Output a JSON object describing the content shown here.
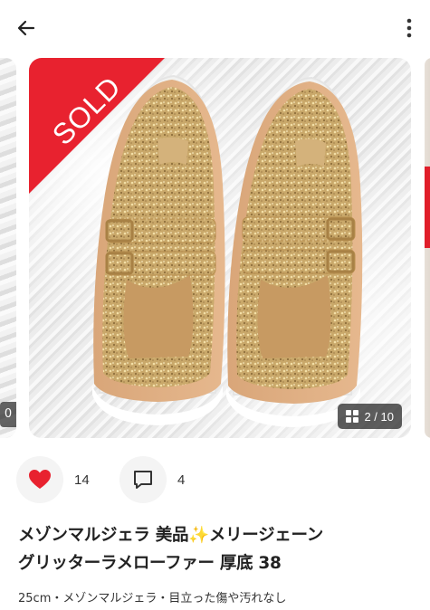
{
  "header": {
    "back_icon": "arrow-left-icon",
    "more_icon": "more-vertical-icon"
  },
  "gallery": {
    "sold_label": "SOLD",
    "photo_counter": "2 / 10",
    "left_peek_counter": "0",
    "counter_icon": "grid-icon",
    "ribbon_color": "#e8222f"
  },
  "actions": {
    "like_count": "14",
    "comment_count": "4",
    "like_color": "#e8222f"
  },
  "item": {
    "title_line1": "メゾンマルジェラ 美品✨メリージェーン",
    "title_line2": "グリッターラメローファー 厚底 38",
    "subtitle": "25cm・メゾンマルジェラ・目立った傷や汚れなし"
  }
}
